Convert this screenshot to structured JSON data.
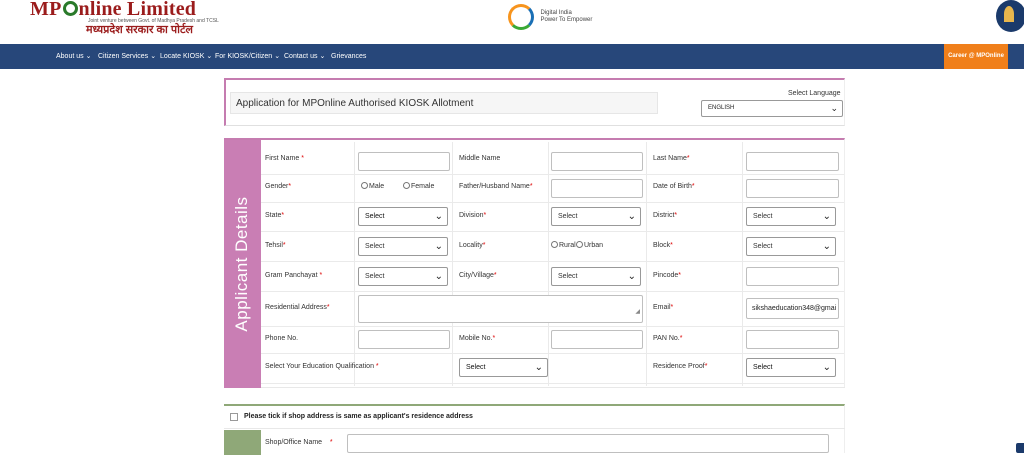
{
  "header": {
    "logo_main_pre": "MP",
    "logo_main_post": "nline Limited",
    "logo_tagline": "Joint venture between Govt. of Madhya Pradesh and TCSL",
    "logo_hindi": "मध्यप्रदेश सरकार का पोर्टल",
    "digital_india": "Digital India",
    "digital_india_sub": "Power To Empower"
  },
  "nav": {
    "items": [
      {
        "label": "About us"
      },
      {
        "label": "Citizen Services"
      },
      {
        "label": "Locate KIOSK"
      },
      {
        "label": "For KIOSK/Citizen"
      },
      {
        "label": "Contact us"
      },
      {
        "label": "Grievances"
      }
    ],
    "career": "Career @ MPOnline"
  },
  "form_header": {
    "title": "Application for MPOnline Authorised KIOSK Allotment",
    "language_label": "Select Language",
    "language_value": "ENGLISH"
  },
  "section_title": "Applicant Details",
  "fields": {
    "first_name": {
      "label": "First Name",
      "value": ""
    },
    "middle_name": {
      "label": "Middle Name",
      "value": ""
    },
    "last_name": {
      "label": "Last Name",
      "value": ""
    },
    "gender": {
      "label": "Gender",
      "options": [
        "Male",
        "Female"
      ]
    },
    "father_name": {
      "label": "Father/Husband Name",
      "value": ""
    },
    "dob": {
      "label": "Date of Birth",
      "value": ""
    },
    "state": {
      "label": "State",
      "value": "Select"
    },
    "division": {
      "label": "Division",
      "value": "Select"
    },
    "district": {
      "label": "District",
      "value": "Select"
    },
    "tehsil": {
      "label": "Tehsil",
      "value": "Select"
    },
    "locality": {
      "label": "Locality",
      "options": [
        "Rural",
        "Urban"
      ]
    },
    "block": {
      "label": "Block",
      "value": "Select"
    },
    "gram_panchayat": {
      "label": "Gram Panchayat",
      "value": "Select"
    },
    "city_village": {
      "label": "City/Village",
      "value": "Select"
    },
    "pincode": {
      "label": "Pincode",
      "value": ""
    },
    "residential_address": {
      "label": "Residential Address",
      "value": ""
    },
    "email": {
      "label": "Email",
      "value": "sikshaeducation348@gmai"
    },
    "phone": {
      "label": "Phone No.",
      "value": ""
    },
    "mobile": {
      "label": "Mobile No.",
      "value": ""
    },
    "pan": {
      "label": "PAN No.",
      "value": ""
    },
    "education": {
      "label": "Select Your Education Qualification",
      "value": "Select"
    },
    "residence_proof": {
      "label": "Residence Proof",
      "value": "Select"
    }
  },
  "required_mark": "*",
  "shop": {
    "same_address_label": "Please tick if shop address is same as applicant's residence address",
    "shop_name_label": "Shop/Office Name",
    "shop_name_value": ""
  },
  "colors": {
    "nav_bg": "#27477a",
    "career_bg": "#f07f1a",
    "section_accent": "#c97eb4",
    "shop_accent": "#8fa878"
  }
}
